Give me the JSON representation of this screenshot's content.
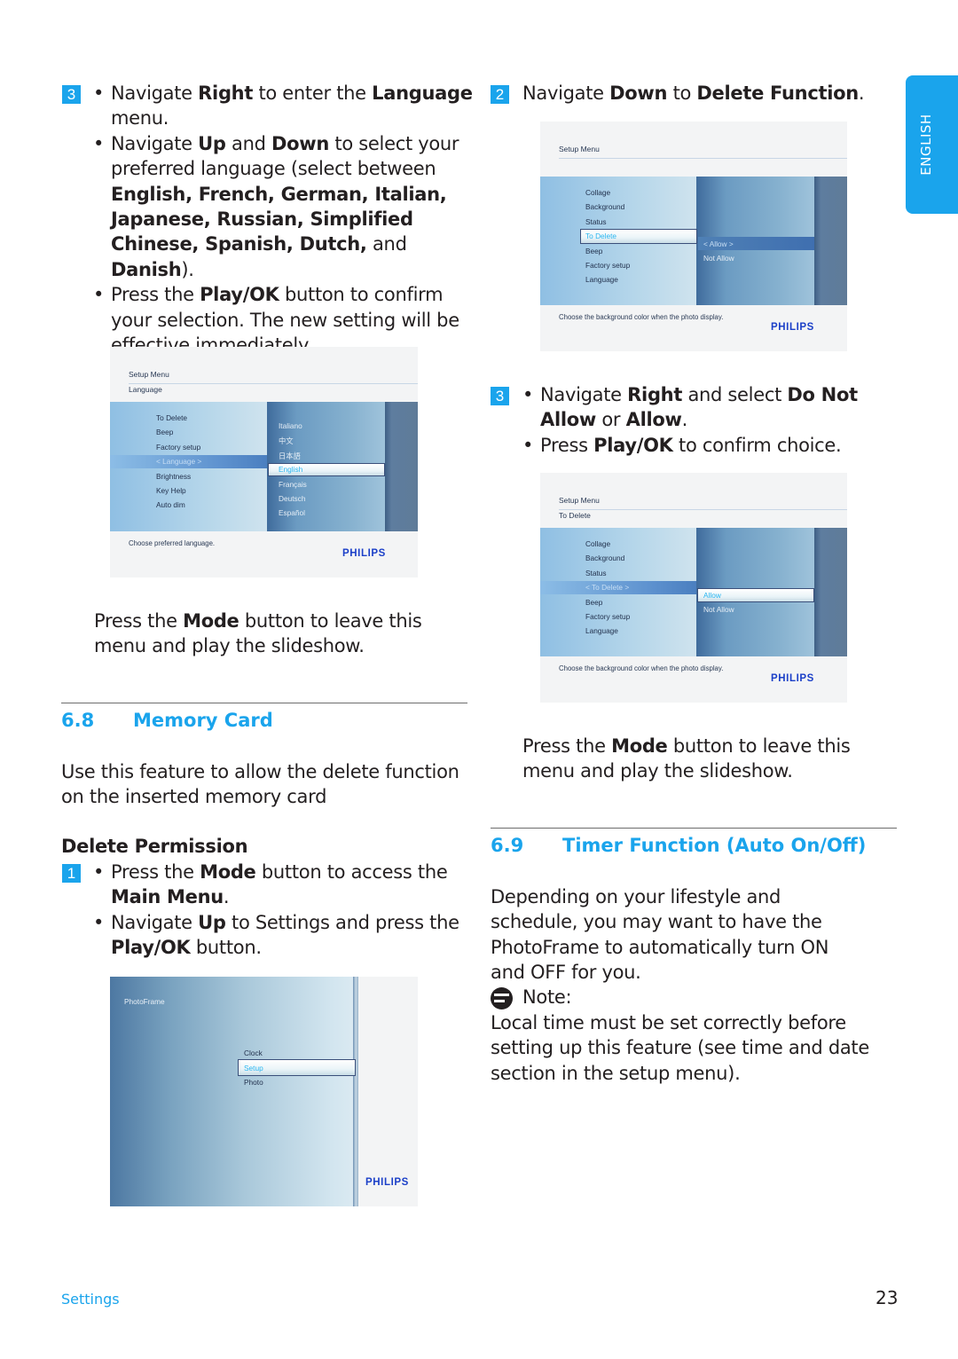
{
  "side_tab": {
    "label": "ENGLISH"
  },
  "left": {
    "step3": {
      "num": "3",
      "bullets": [
        [
          {
            "t": "Navigate "
          },
          {
            "b": "Right"
          },
          {
            "t": " to enter the "
          },
          {
            "b": "Language"
          },
          {
            "t": " menu."
          }
        ],
        [
          {
            "t": "Navigate "
          },
          {
            "b": "Up"
          },
          {
            "t": " and "
          },
          {
            "b": "Down"
          },
          {
            "t": " to select your preferred language (select between "
          },
          {
            "b": "English, French, German, Italian, Japanese, Russian, Simplified Chinese, Spanish, Dutch,"
          },
          {
            "t": " and "
          },
          {
            "b": "Danish"
          },
          {
            "t": ")."
          }
        ],
        [
          {
            "t": "Press the "
          },
          {
            "b": "Play/OK"
          },
          {
            "t": " button to confirm your selection. The new setting will be effective immediately."
          }
        ]
      ]
    },
    "shot_language": {
      "title": "Setup Menu",
      "subtitle": "Language",
      "menu_items": [
        "To Delete",
        "Beep",
        "Factory setup",
        "< Language >",
        "Brightness",
        "Key Help",
        "Auto dim"
      ],
      "highlighted_item": "< Language >",
      "options": [
        "Italiano",
        "中文",
        "日本語",
        "English",
        "Français",
        "Deutsch",
        "Español"
      ],
      "selected_option": "English",
      "footer": "Choose preferred language.",
      "brand": "PHILIPS"
    },
    "mode_para": [
      {
        "t": "Press the "
      },
      {
        "b": "Mode"
      },
      {
        "t": " button to leave this menu and play the slideshow."
      }
    ],
    "section": {
      "number": "6.8",
      "title": "Memory Card"
    },
    "intro": "Use this feature to allow the delete function on the inserted memory card",
    "subheading": "Delete Permission",
    "step1": {
      "num": "1",
      "bullets": [
        [
          {
            "t": "Press the "
          },
          {
            "b": "Mode"
          },
          {
            "t": " button to access the "
          },
          {
            "b": "Main Menu"
          },
          {
            "t": "."
          }
        ],
        [
          {
            "t": "Navigate "
          },
          {
            "b": "Up"
          },
          {
            "t": " to Settings and press the "
          },
          {
            "b": "Play/OK"
          },
          {
            "t": " button."
          }
        ]
      ]
    },
    "shot_main": {
      "title": "PhotoFrame",
      "items": [
        "Clock",
        "Setup",
        "Photo"
      ],
      "selected_item": "Setup",
      "brand": "PHILIPS"
    }
  },
  "right": {
    "step2": {
      "num": "2",
      "text": [
        {
          "t": "Navigate "
        },
        {
          "b": "Down"
        },
        {
          "t": " to "
        },
        {
          "b": "Delete Function"
        },
        {
          "t": "."
        }
      ]
    },
    "shot_delete1": {
      "title": "Setup Menu",
      "menu_items": [
        "Collage",
        "Background",
        "Status",
        "To Delete",
        "Beep",
        "Factory setup",
        "Language"
      ],
      "selected_item": "To Delete",
      "options": [
        "< Allow >",
        "Not Allow"
      ],
      "highlighted_option": "< Allow >",
      "footer": "Choose the background color when the photo display.",
      "brand": "PHILIPS"
    },
    "step3": {
      "num": "3",
      "bullets": [
        [
          {
            "t": "Navigate "
          },
          {
            "b": "Right"
          },
          {
            "t": " and select "
          },
          {
            "b": "Do Not Allow"
          },
          {
            "t": " or "
          },
          {
            "b": "Allow"
          },
          {
            "t": "."
          }
        ],
        [
          {
            "t": "Press "
          },
          {
            "b": "Play/OK"
          },
          {
            "t": " to confirm choice."
          }
        ]
      ]
    },
    "shot_delete2": {
      "title": "Setup Menu",
      "subtitle": "To Delete",
      "menu_items": [
        "Collage",
        "Background",
        "Status",
        "< To Delete >",
        "Beep",
        "Factory setup",
        "Language"
      ],
      "highlighted_item": "< To Delete >",
      "options": [
        "Allow",
        "Not Allow"
      ],
      "selected_option": "Allow",
      "footer": "Choose the background color when the photo display.",
      "brand": "PHILIPS"
    },
    "mode_para": [
      {
        "t": "Press the "
      },
      {
        "b": "Mode"
      },
      {
        "t": " button to leave this menu and play the slideshow."
      }
    ],
    "section": {
      "number": "6.9",
      "title": "Timer Function (Auto On/Off)"
    },
    "intro": "Depending on your lifestyle and schedule, you may want to have the PhotoFrame to automatically turn ON and OFF for you.",
    "note": {
      "icon": "note-icon",
      "label": "Note:",
      "text": "Local time must be set correctly before setting up this feature (see time and date section in the setup menu)."
    }
  },
  "footer": {
    "section_label": "Settings",
    "page_number": "23"
  },
  "colors": {
    "accent": "#1aa4ec",
    "text": "#231f20",
    "brand": "#1c40c8"
  }
}
